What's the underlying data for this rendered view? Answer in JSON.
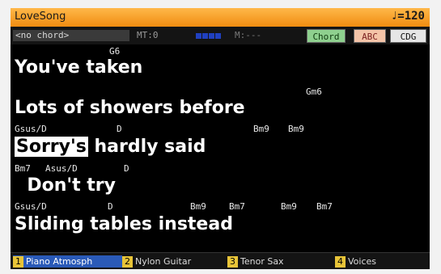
{
  "song": {
    "title": "LoveSong",
    "tempo": "♩=120"
  },
  "info": {
    "chord_display": "<no chord>",
    "mt_label": "MT:0",
    "m_label": "M:---"
  },
  "buttons": {
    "chord": "Chord",
    "abc": "ABC",
    "cdg": "CDG"
  },
  "lyrics": [
    {
      "chords": [
        "G6"
      ],
      "pre": "You've taken",
      "hl": "",
      "post": ""
    },
    {
      "chords": [
        "Gm6"
      ],
      "pre": "Lots of showers before",
      "hl": "",
      "post": ""
    },
    {
      "chords": [
        "Gsus/D",
        "D",
        "Bm9",
        "Bm9"
      ],
      "pre": "",
      "hl": "Sorry's",
      "post": " hardly said"
    },
    {
      "chords": [
        "Bm7",
        "Asus/D",
        "D"
      ],
      "pre": "  Don't try",
      "hl": "",
      "post": ""
    },
    {
      "chords": [
        "Gsus/D",
        "D",
        "Bm9",
        "Bm7",
        "Bm9",
        "Bm7"
      ],
      "pre": "Sliding tables instead",
      "hl": "",
      "post": ""
    }
  ],
  "tracks": [
    {
      "num": "1",
      "name": "Piano Atmosph"
    },
    {
      "num": "2",
      "name": "Nylon Guitar"
    },
    {
      "num": "3",
      "name": "Tenor Sax"
    },
    {
      "num": "4",
      "name": "Voices"
    }
  ],
  "colors": {
    "title_bar": "#f5a02c",
    "selected_track": "#2a5ab8",
    "highlight_bg": "#ffffff",
    "chord_button": "#8ed08e",
    "abc_button": "#f4c4a8"
  }
}
